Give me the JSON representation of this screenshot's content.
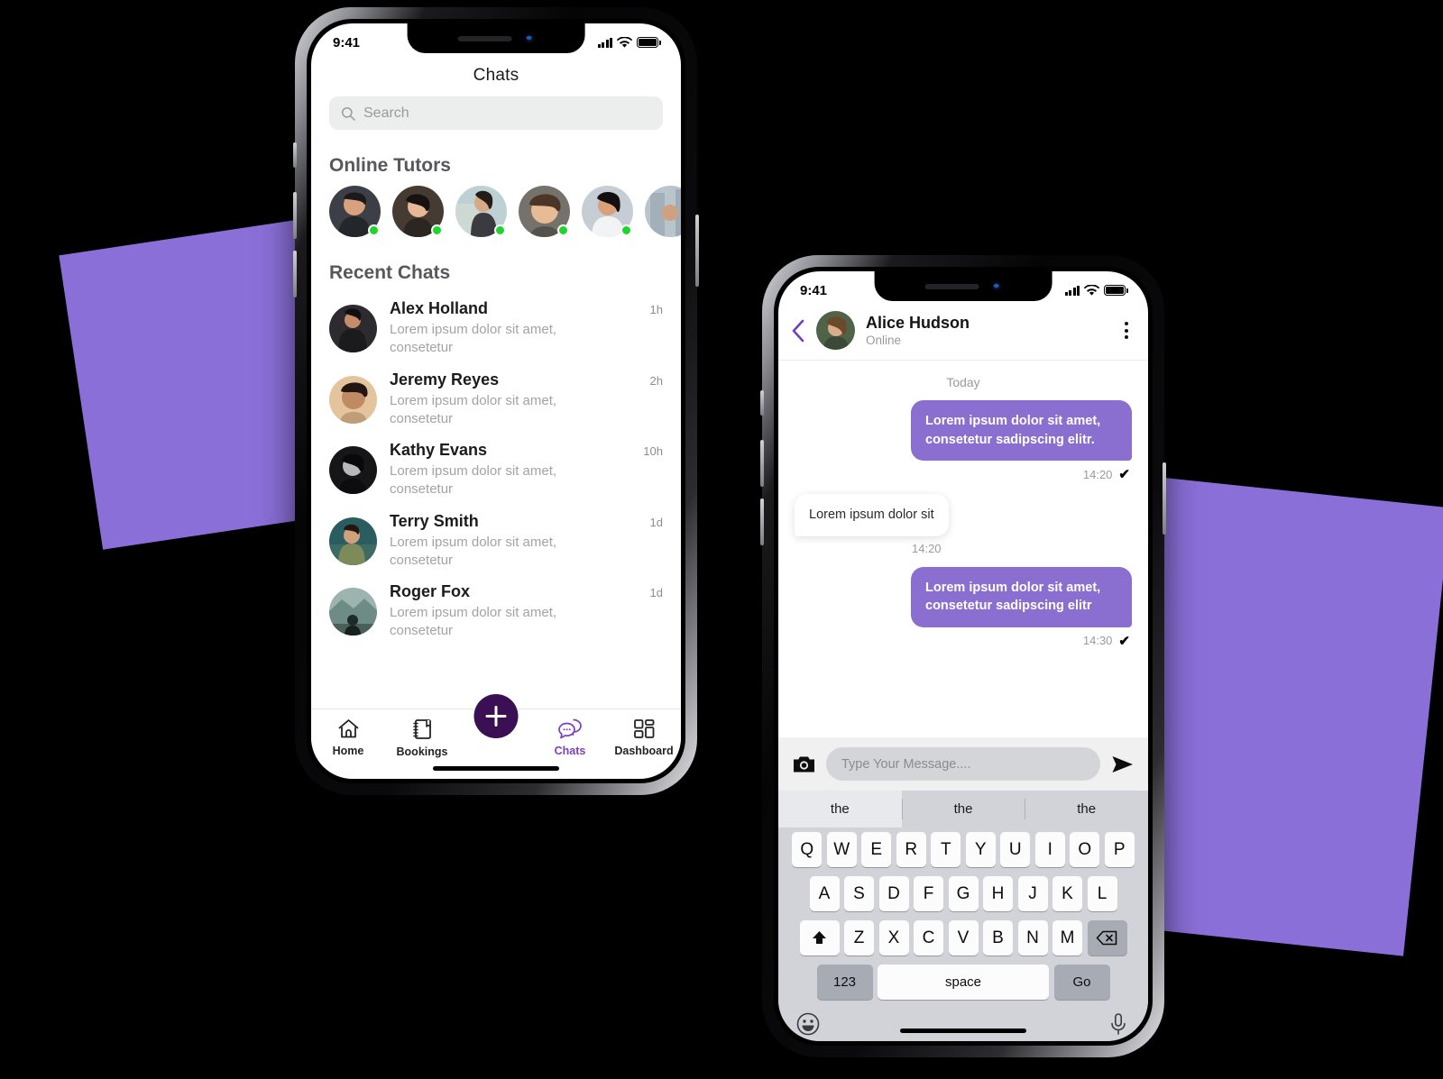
{
  "theme": {
    "accent_purple": "#8a6fd0",
    "deep_purple": "#3b0f53",
    "tab_active": "#7b3fbf",
    "shape_purple": "#8a6fd8",
    "online_green": "#1fd42b"
  },
  "phone_chats": {
    "status": {
      "time": "9:41",
      "signal_icon": "cellular-bars-icon",
      "wifi_icon": "wifi-icon",
      "battery_icon": "battery-icon"
    },
    "header": {
      "title": "Chats"
    },
    "search": {
      "placeholder": "Search",
      "icon": "search-icon"
    },
    "online_tutors": {
      "title": "Online Tutors",
      "avatars": [
        {
          "name": "tutor-1",
          "online": true
        },
        {
          "name": "tutor-2",
          "online": true
        },
        {
          "name": "tutor-3",
          "online": true
        },
        {
          "name": "tutor-4",
          "online": true
        },
        {
          "name": "tutor-5",
          "online": true
        },
        {
          "name": "tutor-6",
          "online": true
        }
      ]
    },
    "recent_chats": {
      "title": "Recent Chats",
      "items": [
        {
          "name": "Alex Holland",
          "message": "Lorem ipsum dolor sit amet, consetetur",
          "time": "1h"
        },
        {
          "name": "Jeremy Reyes",
          "message": "Lorem ipsum dolor sit amet, consetetur",
          "time": "2h"
        },
        {
          "name": "Kathy Evans",
          "message": "Lorem ipsum dolor sit amet, consetetur",
          "time": "10h"
        },
        {
          "name": "Terry Smith",
          "message": "Lorem ipsum dolor sit amet, consetetur",
          "time": "1d"
        },
        {
          "name": "Roger Fox",
          "message": "Lorem ipsum dolor sit amet, consetetur",
          "time": "1d"
        }
      ]
    },
    "tabbar": {
      "add_button_icon": "plus-icon",
      "tabs": [
        {
          "label": "Home",
          "icon": "home-icon",
          "active": false
        },
        {
          "label": "Bookings",
          "icon": "notebook-icon",
          "active": false
        },
        {
          "label": "Chats",
          "icon": "chat-bubble-icon",
          "active": true
        },
        {
          "label": "Dashboard",
          "icon": "grid-icon",
          "active": false
        }
      ]
    }
  },
  "phone_conversation": {
    "status": {
      "time": "9:41",
      "signal_icon": "cellular-bars-icon",
      "wifi_icon": "wifi-icon",
      "battery_icon": "battery-icon"
    },
    "header": {
      "back_icon": "chevron-left-icon",
      "name": "Alice Hudson",
      "status": "Online",
      "menu_icon": "kebab-menu-icon"
    },
    "day_divider": "Today",
    "messages": [
      {
        "side": "out",
        "text": "Lorem ipsum dolor sit amet, consetetur sadipscing elitr.",
        "time": "14:20",
        "tick": "✔"
      },
      {
        "side": "in",
        "text": "Lorem ipsum dolor sit",
        "time": "14:20",
        "tick": ""
      },
      {
        "side": "out",
        "text": "Lorem ipsum dolor sit amet, consetetur sadipscing elitr",
        "time": "14:30",
        "tick": "✔"
      }
    ],
    "composer": {
      "camera_icon": "camera-icon",
      "placeholder": "Type Your Message....",
      "send_icon": "send-icon"
    },
    "keyboard": {
      "suggestions": [
        "the",
        "the",
        "the"
      ],
      "row1": [
        "Q",
        "W",
        "E",
        "R",
        "T",
        "Y",
        "U",
        "I",
        "O",
        "P"
      ],
      "row2": [
        "A",
        "S",
        "D",
        "F",
        "G",
        "H",
        "J",
        "K",
        "L"
      ],
      "row3": [
        "Z",
        "X",
        "C",
        "V",
        "B",
        "N",
        "M"
      ],
      "shift_icon": "shift-icon",
      "backspace_icon": "backspace-icon",
      "numbers_key": "123",
      "space_key": "space",
      "go_key": "Go",
      "emoji_icon": "emoji-icon",
      "mic_icon": "microphone-icon"
    }
  }
}
